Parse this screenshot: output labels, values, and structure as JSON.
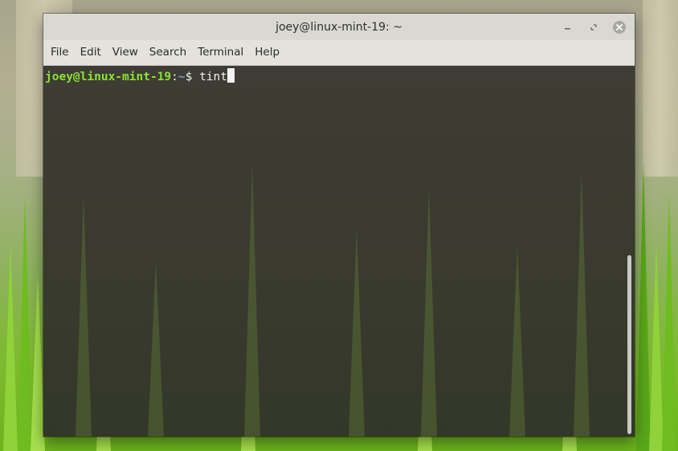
{
  "window": {
    "title": "joey@linux-mint-19: ~"
  },
  "menubar": {
    "items": [
      "File",
      "Edit",
      "View",
      "Search",
      "Terminal",
      "Help"
    ]
  },
  "terminal": {
    "prompt_user_host": "joey@linux-mint-19",
    "prompt_colon": ":",
    "prompt_path": "~",
    "prompt_symbol": "$ ",
    "command": "tint"
  },
  "icons": {
    "minimize": "minimize-icon",
    "maximize": "maximize-icon",
    "close": "close-icon"
  },
  "colors": {
    "prompt_user": "#8ae234",
    "prompt_path": "#729fcf",
    "close_button": "#a9a89f",
    "titlebar": "#d9d8d2"
  }
}
